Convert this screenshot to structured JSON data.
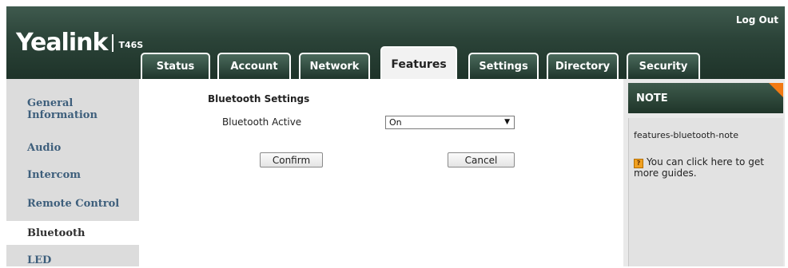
{
  "header": {
    "logo_text": "Yealink",
    "model": "T46S",
    "logout_label": "Log Out"
  },
  "tabs": [
    {
      "label": "Status"
    },
    {
      "label": "Account"
    },
    {
      "label": "Network"
    },
    {
      "label": "Features",
      "active": true
    },
    {
      "label": "Settings"
    },
    {
      "label": "Directory"
    },
    {
      "label": "Security"
    }
  ],
  "sidebar": {
    "items": [
      {
        "label": "General\nInformation"
      },
      {
        "label": "Audio"
      },
      {
        "label": "Intercom"
      },
      {
        "label": "Remote Control"
      },
      {
        "label": "Bluetooth",
        "active": true
      },
      {
        "label": "LED"
      }
    ]
  },
  "main": {
    "section_title": "Bluetooth Settings",
    "bluetooth_active_label": "Bluetooth Active",
    "bluetooth_active_value": "On",
    "confirm_label": "Confirm",
    "cancel_label": "Cancel"
  },
  "note": {
    "title": "NOTE",
    "text": "features-bluetooth-note",
    "guide_text": "You can click here to get more guides."
  },
  "colors": {
    "header_dark": "#1e3329",
    "sidebar_link": "#3e5f7c",
    "note_corner": "#f27a14"
  }
}
